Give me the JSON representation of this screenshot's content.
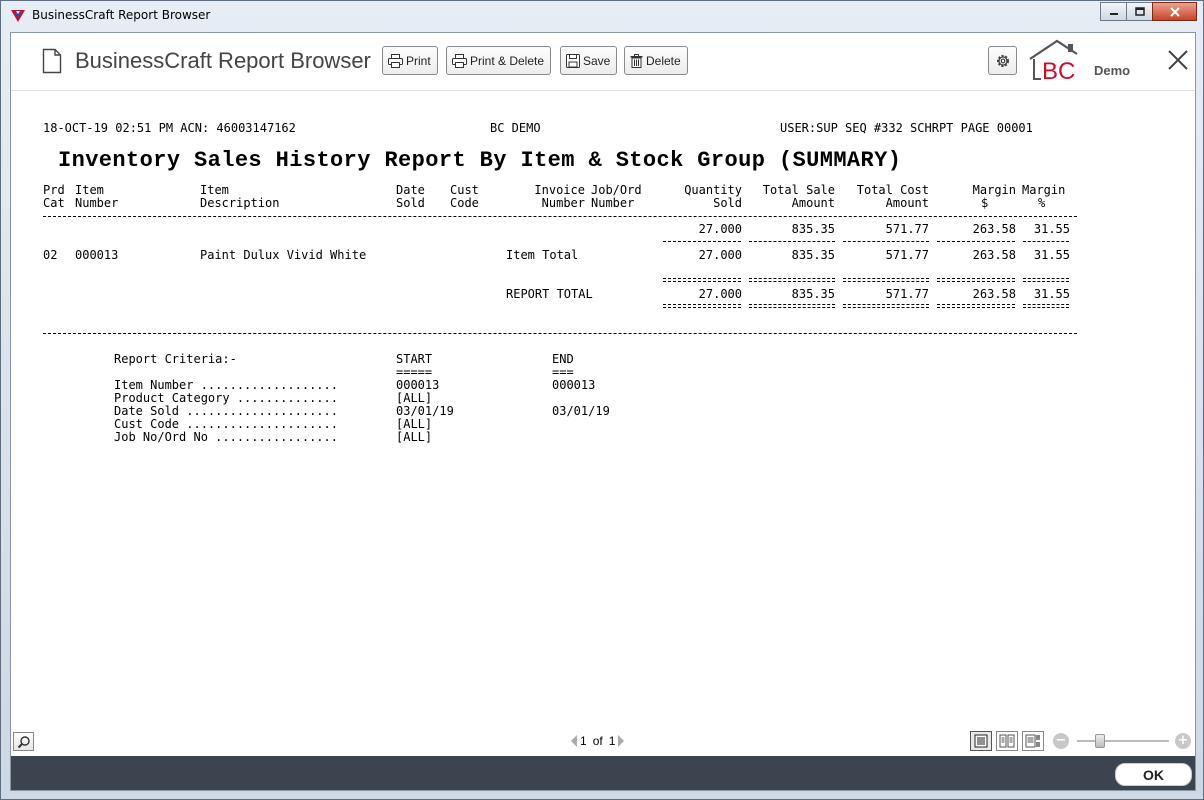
{
  "window": {
    "title": "BusinessCraft Report Browser"
  },
  "header": {
    "title": "BusinessCraft Report Browser",
    "buttons": {
      "print": "Print",
      "print_delete": "Print & Delete",
      "save": "Save",
      "delete": "Delete"
    },
    "logo_text": "BC",
    "logo_label": "Demo"
  },
  "report": {
    "meta_left": "18-OCT-19 02:51 PM ACN: 46003147162",
    "meta_center": "BC DEMO",
    "meta_right": "USER:SUP SEQ #332 SCHRPT PAGE 00001",
    "title": "Inventory Sales History Report By Item & Stock Group (SUMMARY)",
    "columns": {
      "prd_cat": [
        "Prd",
        "Cat"
      ],
      "item_number": [
        "Item",
        "Number"
      ],
      "item_description": [
        "Item",
        "Description"
      ],
      "date_sold": [
        "Date",
        "Sold"
      ],
      "cust_code": [
        "Cust",
        "Code"
      ],
      "invoice_number": [
        "Invoice",
        "Number"
      ],
      "job_ord_number": [
        "Job/Ord",
        "Number"
      ],
      "quantity_sold": [
        "Quantity",
        "Sold"
      ],
      "total_sale_amount": [
        "Total Sale",
        "Amount"
      ],
      "total_cost_amount": [
        "Total Cost",
        "Amount"
      ],
      "margin_dollar": [
        "Margin",
        "$"
      ],
      "margin_percent": [
        "Margin",
        "%"
      ]
    },
    "detail_row": {
      "quantity": "27.000",
      "sale": "835.35",
      "cost": "571.77",
      "margin": "263.58",
      "margin_pct": "31.55"
    },
    "item_total_row": {
      "prd_cat": "02",
      "item_number": "000013",
      "description": "Paint Dulux Vivid White",
      "label": "Item Total",
      "quantity": "27.000",
      "sale": "835.35",
      "cost": "571.77",
      "margin": "263.58",
      "margin_pct": "31.55"
    },
    "report_total_row": {
      "label": "REPORT TOTAL",
      "quantity": "27.000",
      "sale": "835.35",
      "cost": "571.77",
      "margin": "263.58",
      "margin_pct": "31.55"
    },
    "criteria": {
      "heading": "Report Criteria:-",
      "start_label": "START",
      "start_underline": "=====",
      "end_label": "END",
      "end_underline": "===",
      "rows": [
        {
          "label": "Item Number ...................",
          "start": "000013",
          "end": "000013"
        },
        {
          "label": "Product Category ..............",
          "start": "[ALL]",
          "end": ""
        },
        {
          "label": "Date Sold .....................",
          "start": "03/01/19",
          "end": "03/01/19"
        },
        {
          "label": "Cust Code .....................",
          "start": "[ALL]",
          "end": ""
        },
        {
          "label": "Job No/Ord No .................",
          "start": "[ALL]",
          "end": ""
        }
      ]
    }
  },
  "pager": {
    "current": "1",
    "of": "of",
    "total": "1"
  },
  "zoom": {
    "minus": "−",
    "plus": "+",
    "level_percent": 25
  },
  "footer": {
    "ok_label": "OK"
  },
  "colors": {
    "footer_bg": "#3c4450",
    "logo_red": "#c8102e",
    "logo_gray": "#555555"
  }
}
